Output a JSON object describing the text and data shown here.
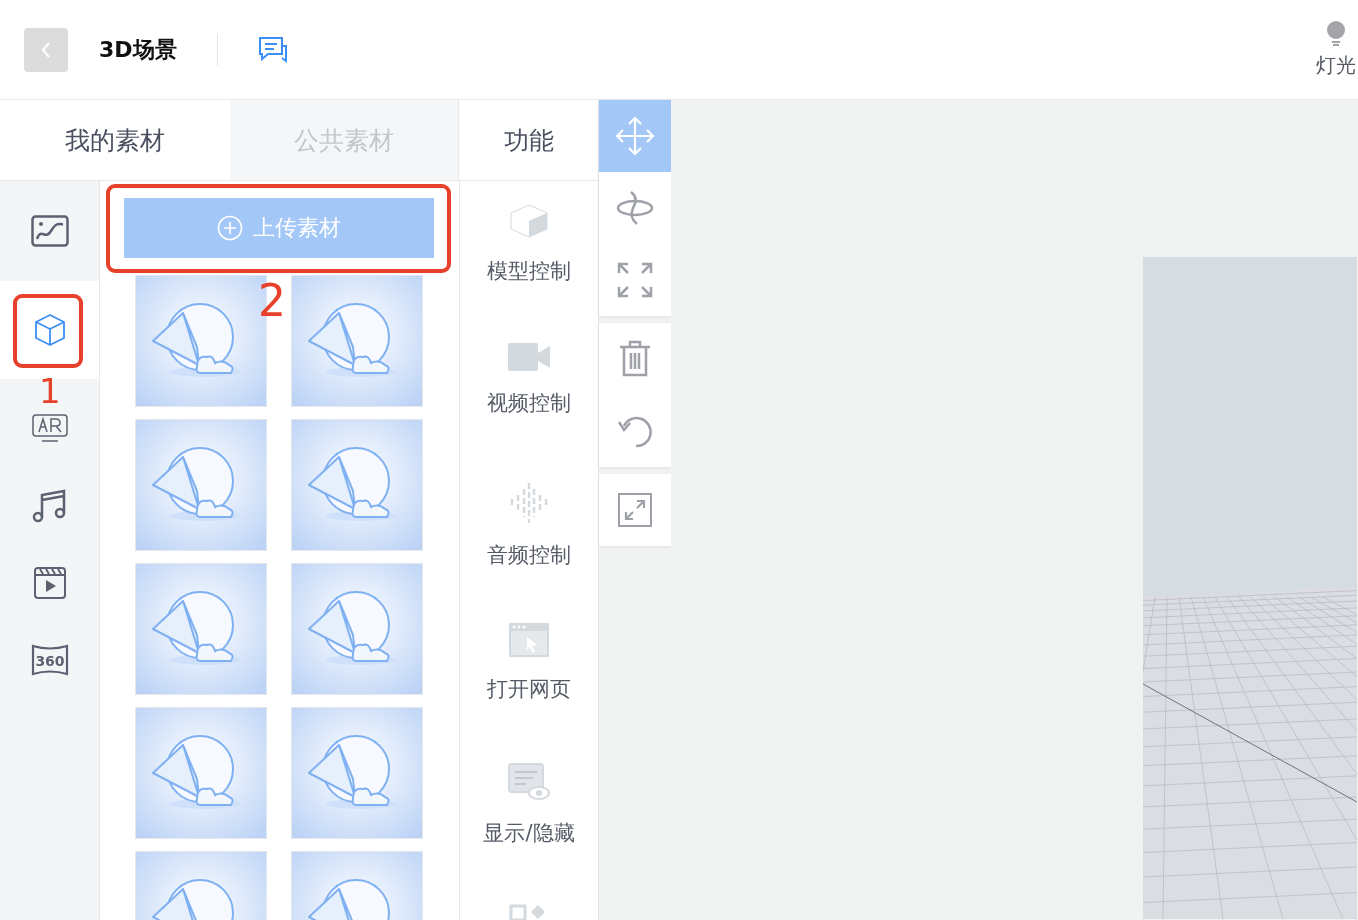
{
  "header": {
    "title": "3D场景",
    "light_label": "灯光"
  },
  "tabs": [
    {
      "label": "我的素材",
      "selected": true
    },
    {
      "label": "公共素材",
      "selected": false
    }
  ],
  "functions_header": "功能",
  "rail": [
    {
      "kind": "image",
      "selected": false
    },
    {
      "kind": "model",
      "selected": true
    },
    {
      "kind": "ar",
      "selected": false
    },
    {
      "kind": "music",
      "selected": false
    },
    {
      "kind": "video",
      "selected": false
    },
    {
      "kind": "panorama",
      "selected": false,
      "label": "360"
    }
  ],
  "upload_button": {
    "label": "上传素材"
  },
  "thumbnails": [
    {
      "kind": "model"
    },
    {
      "kind": "model"
    },
    {
      "kind": "model"
    },
    {
      "kind": "model"
    },
    {
      "kind": "model"
    },
    {
      "kind": "model"
    },
    {
      "kind": "model"
    },
    {
      "kind": "model"
    },
    {
      "kind": "model"
    },
    {
      "kind": "model"
    }
  ],
  "functions": [
    {
      "kind": "model",
      "label": "模型控制"
    },
    {
      "kind": "video",
      "label": "视频控制"
    },
    {
      "kind": "audio",
      "label": "音频控制"
    },
    {
      "kind": "web",
      "label": "打开网页"
    },
    {
      "kind": "visibility",
      "label": "显示/隐藏"
    },
    {
      "kind": "shapes"
    }
  ],
  "tool_groups": [
    [
      {
        "kind": "move",
        "selected": true
      },
      {
        "kind": "rotate",
        "selected": false
      },
      {
        "kind": "scale",
        "selected": false
      }
    ],
    [
      {
        "kind": "delete",
        "selected": false
      },
      {
        "kind": "undo",
        "selected": false
      }
    ],
    [
      {
        "kind": "fullscreen",
        "selected": false
      }
    ]
  ],
  "annotations": [
    {
      "label": "1"
    },
    {
      "label": "2"
    }
  ]
}
